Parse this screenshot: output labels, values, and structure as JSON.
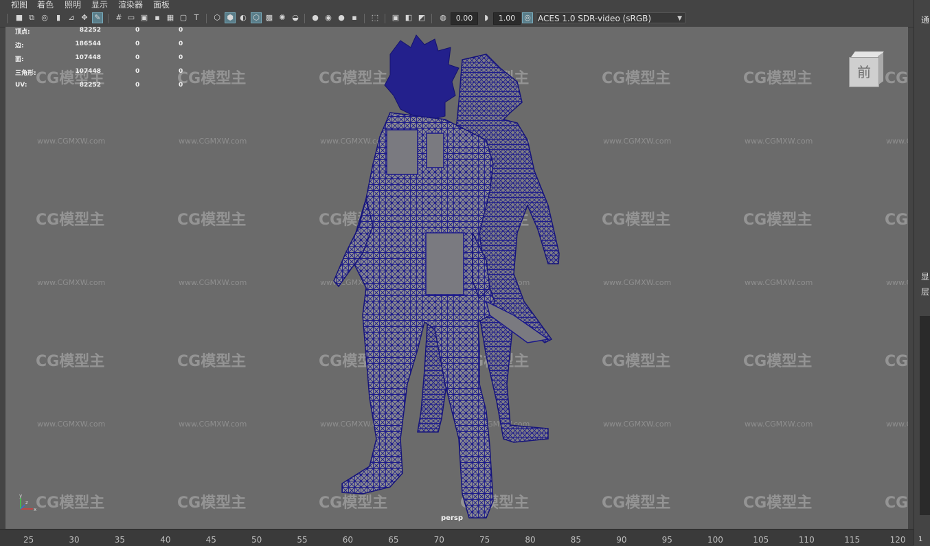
{
  "menu": [
    "视图",
    "着色",
    "照明",
    "显示",
    "渲染器",
    "面板"
  ],
  "toolbar": {
    "exposure_value": "0.00",
    "gamma_value": "1.00",
    "color_management": "ACES 1.0 SDR-video (sRGB)",
    "icons": [
      "camera-select-icon",
      "camera-attributes-icon",
      "bookmark-icon",
      "image-plane-icon",
      "2d-pan-zoom-icon",
      "grease-pencil-icon",
      "grid-icon",
      "film-gate-icon",
      "resolution-gate-icon",
      "gate-mask-icon",
      "field-chart-icon",
      "safe-action-icon",
      "safe-title-icon",
      "wireframe-icon",
      "smooth-shade-icon",
      "default-material-icon",
      "wireframe-on-shaded-icon",
      "textured-icon",
      "use-all-lights-icon",
      "shadows-icon",
      "screen-space-ao-icon",
      "motion-blur-icon",
      "multisample-aa-icon",
      "depth-of-field-icon",
      "isolate-select-icon",
      "xray-icon",
      "xray-joints-icon",
      "xray-components-icon",
      "exposure-icon",
      "gamma-icon",
      "color-management-icon"
    ]
  },
  "hud": {
    "rows": [
      {
        "label": "顶点:",
        "v1": "82252",
        "v2": "0",
        "v3": "0"
      },
      {
        "label": "边:",
        "v1": "186544",
        "v2": "0",
        "v3": "0"
      },
      {
        "label": "面:",
        "v1": "107448",
        "v2": "0",
        "v3": "0"
      },
      {
        "label": "三角形:",
        "v1": "107448",
        "v2": "0",
        "v3": "0"
      },
      {
        "label": "UV:",
        "v1": "82252",
        "v2": "0",
        "v3": "0"
      }
    ]
  },
  "viewcube_label": "前",
  "camera_label": "persp",
  "watermark": {
    "logo": "CG模型主",
    "url": "www.CGMXW.com"
  },
  "timeline_ticks": [
    "25",
    "30",
    "35",
    "40",
    "45",
    "50",
    "55",
    "60",
    "65",
    "70",
    "75",
    "80",
    "85",
    "90",
    "95",
    "100",
    "105",
    "110",
    "115",
    "120"
  ],
  "right_panel": {
    "top_label": "通",
    "label_a": "显",
    "label_b": "层",
    "frame": "1"
  },
  "colors": {
    "wireframe": "#1c1a8a",
    "mesh_fill": "#8a8a8c",
    "viewport_bg": "#6b6b6b",
    "ui_bg": "#444444"
  }
}
